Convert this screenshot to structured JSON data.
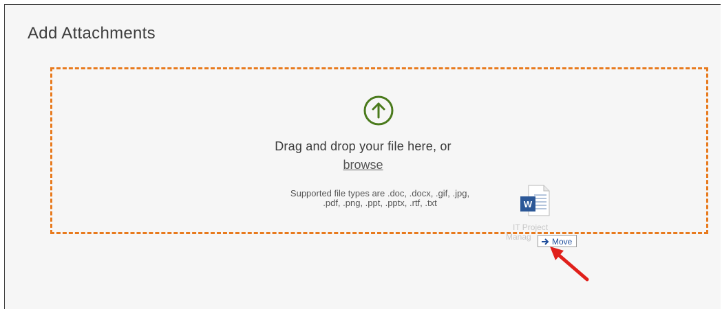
{
  "header": {
    "title": "Add Attachments"
  },
  "dropzone": {
    "drag_text": "Drag and drop your file here, or",
    "browse_label": "browse",
    "supported_line1": "Supported file types are .doc, .docx, .gif, .jpg,",
    "supported_line2": ".pdf, .png, .ppt, .pptx, .rtf, .txt"
  },
  "drag_file": {
    "caption_line1": "IT Project",
    "caption_line2": "Manag",
    "icon": "word-document-icon"
  },
  "tooltip": {
    "label": "Move",
    "icon": "arrow-right-icon"
  },
  "colors": {
    "accent_orange": "#e87a1d",
    "upload_green": "#4a7a1c",
    "annotation_red": "#e0201b"
  }
}
